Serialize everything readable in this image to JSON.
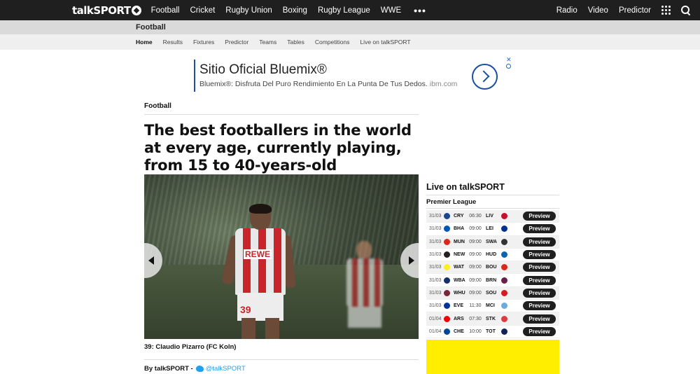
{
  "brand": {
    "logo_text": "talkSPORT"
  },
  "topnav": {
    "left_items": [
      "Football",
      "Cricket",
      "Rugby Union",
      "Boxing",
      "Rugby League",
      "WWE"
    ],
    "more": "•••",
    "right_items": [
      "Radio",
      "Video",
      "Predictor"
    ]
  },
  "section": {
    "title": "Football"
  },
  "subnav": {
    "items": [
      "Home",
      "Results",
      "Fixtures",
      "Predictor",
      "Teams",
      "Tables",
      "Competitions",
      "Live on talkSPORT"
    ],
    "active": "Home"
  },
  "ad": {
    "title": "Sitio Oficial Bluemix®",
    "subtitle": "Bluemix®: Disfruta Del Puro Rendimiento En La Punta De Tus Dedos.",
    "domain": "ibm.com",
    "close": "✕"
  },
  "article": {
    "category": "Football",
    "headline_lines": [
      "The best footballers in the world",
      "at every age, currently playing,",
      "from 15 to 40-years-old"
    ],
    "photo_shirt_sponsor": "REWE",
    "photo_shirt_number": "39",
    "caption": "39: Claudio Pizarro (FC Koln)",
    "byline": "By talkSPORT -",
    "twitter": "@talkSPORT"
  },
  "sidebar": {
    "title": "Live on talkSPORT",
    "league": "Premier League",
    "button_label": "Preview",
    "fixtures": [
      {
        "date": "31/03",
        "home": "CRY",
        "time": "06:30",
        "away": "LIV",
        "home_color": "#1b458f",
        "away_color": "#c8102e"
      },
      {
        "date": "31/03",
        "home": "BHA",
        "time": "09:00",
        "away": "LEI",
        "home_color": "#0057b8",
        "away_color": "#003090"
      },
      {
        "date": "31/03",
        "home": "MUN",
        "time": "09:00",
        "away": "SWA",
        "home_color": "#da291c",
        "away_color": "#333333"
      },
      {
        "date": "31/03",
        "home": "NEW",
        "time": "09:00",
        "away": "HUD",
        "home_color": "#241f20",
        "away_color": "#0e63ad"
      },
      {
        "date": "31/03",
        "home": "WAT",
        "time": "09:00",
        "away": "BOU",
        "home_color": "#fbee23",
        "away_color": "#da291c"
      },
      {
        "date": "31/03",
        "home": "WBA",
        "time": "09:00",
        "away": "BRN",
        "home_color": "#122f67",
        "away_color": "#6c1d45"
      },
      {
        "date": "31/03",
        "home": "WHU",
        "time": "09:00",
        "away": "SOU",
        "home_color": "#7a263a",
        "away_color": "#d71920"
      },
      {
        "date": "31/03",
        "home": "EVE",
        "time": "11:30",
        "away": "MCI",
        "home_color": "#003399",
        "away_color": "#6cabdd"
      },
      {
        "date": "01/04",
        "home": "ARS",
        "time": "07:30",
        "away": "STK",
        "home_color": "#ef0107",
        "away_color": "#e03a3e"
      },
      {
        "date": "01/04",
        "home": "CHE",
        "time": "10:00",
        "away": "TOT",
        "home_color": "#034694",
        "away_color": "#132257"
      }
    ]
  }
}
